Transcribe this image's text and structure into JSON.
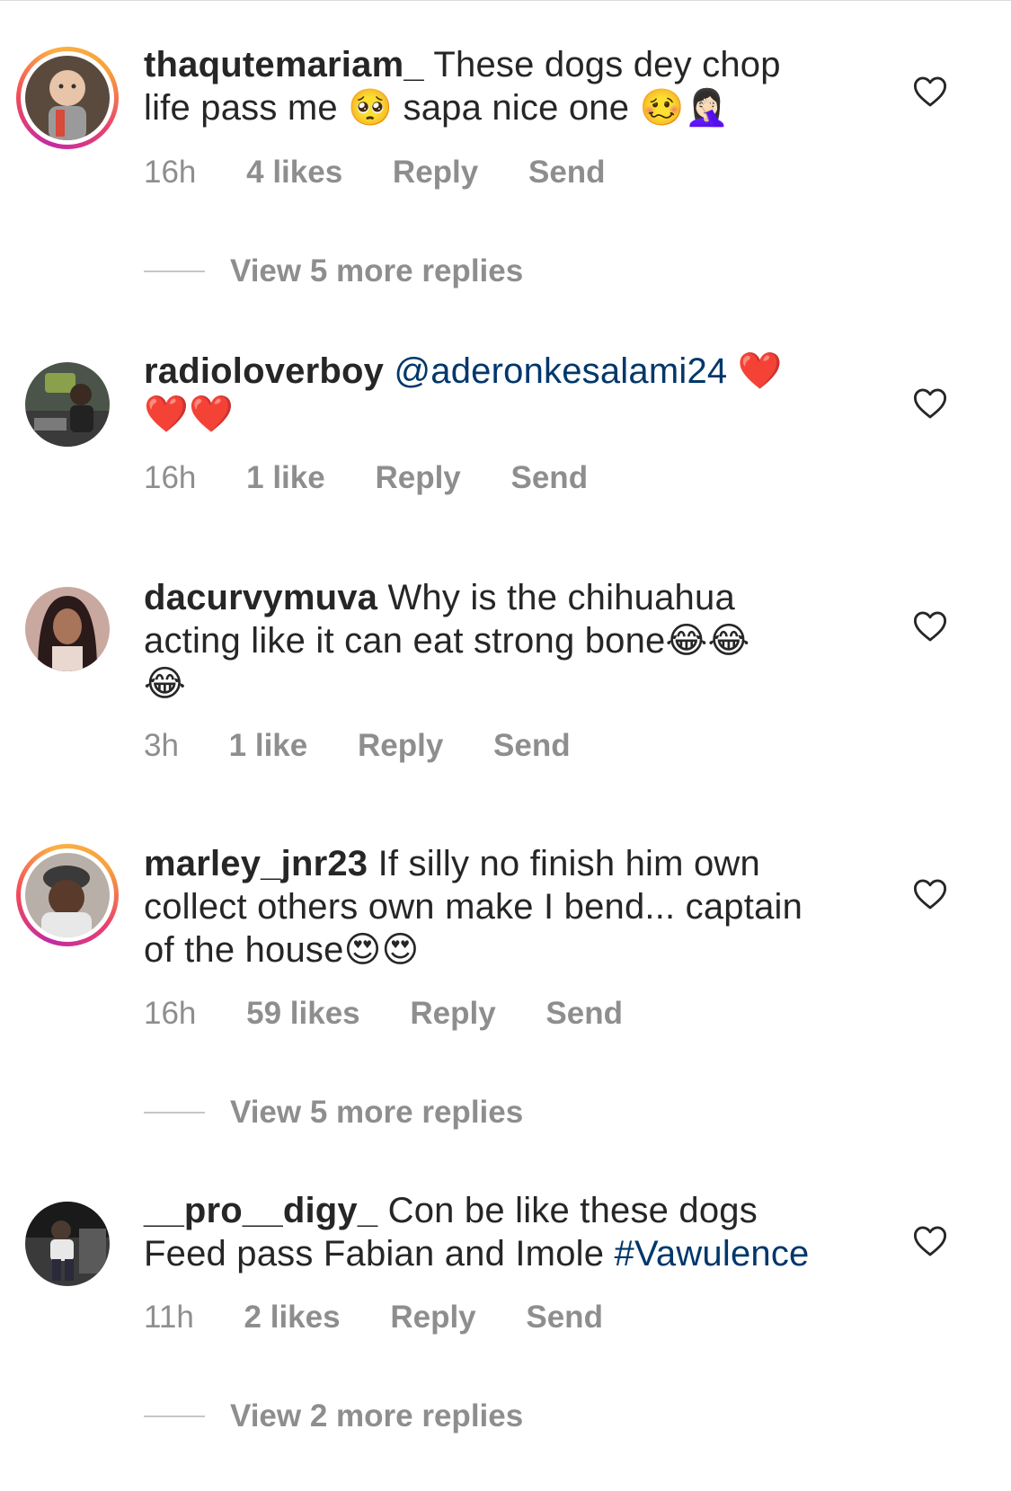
{
  "comments": [
    {
      "username": "thaqutemariam_",
      "text_line1": "These dogs dey chop",
      "text_line2": "life pass me",
      "emoji1": "🥺",
      "text_line2b": "sapa nice one",
      "emoji2": "🥴🤦🏻‍♀️",
      "time": "16h",
      "likes": "4 likes",
      "reply": "Reply",
      "send": "Send",
      "view_replies": "View 5 more replies",
      "avatar_color": "#7a5a48"
    },
    {
      "username": "radioloverboy",
      "mention": "@aderonkesalami24",
      "emoji1": "❤️",
      "emoji2": "❤️❤️",
      "time": "16h",
      "likes": "1 like",
      "reply": "Reply",
      "send": "Send",
      "avatar_color": "#5c6a5a"
    },
    {
      "username": "dacurvymuva",
      "text_line1": "Why is the chihuahua",
      "text_line2": "acting like it can eat strong bone",
      "emoji1": "😂😂",
      "emoji2": "😂",
      "time": "3h",
      "likes": "1 like",
      "reply": "Reply",
      "send": "Send",
      "avatar_color": "#9a6a6a"
    },
    {
      "username": "marley_jnr23",
      "text_line1": "If silly no finish him own",
      "text_line2": "collect others own make I bend... captain",
      "text_line3": "of the house",
      "emoji1": "😍😍",
      "time": "16h",
      "likes": "59 likes",
      "reply": "Reply",
      "send": "Send",
      "view_replies": "View 5 more replies",
      "avatar_color": "#8a8a8a"
    },
    {
      "username": "__pro__digy_",
      "text_line1": "Con be like these dogs",
      "text_line2": "Feed pass Fabian and Imole",
      "hashtag": "#Vawulence",
      "time": "11h",
      "likes": "2 likes",
      "reply": "Reply",
      "send": "Send",
      "view_replies": "View 2 more replies",
      "avatar_color": "#6a6a6a"
    }
  ],
  "colors": {
    "username": "#262626",
    "meta": "#8e8e8e",
    "link": "#00376b",
    "story_ring": "#e8416e"
  },
  "icons": {
    "like": "heart-outline-icon"
  }
}
